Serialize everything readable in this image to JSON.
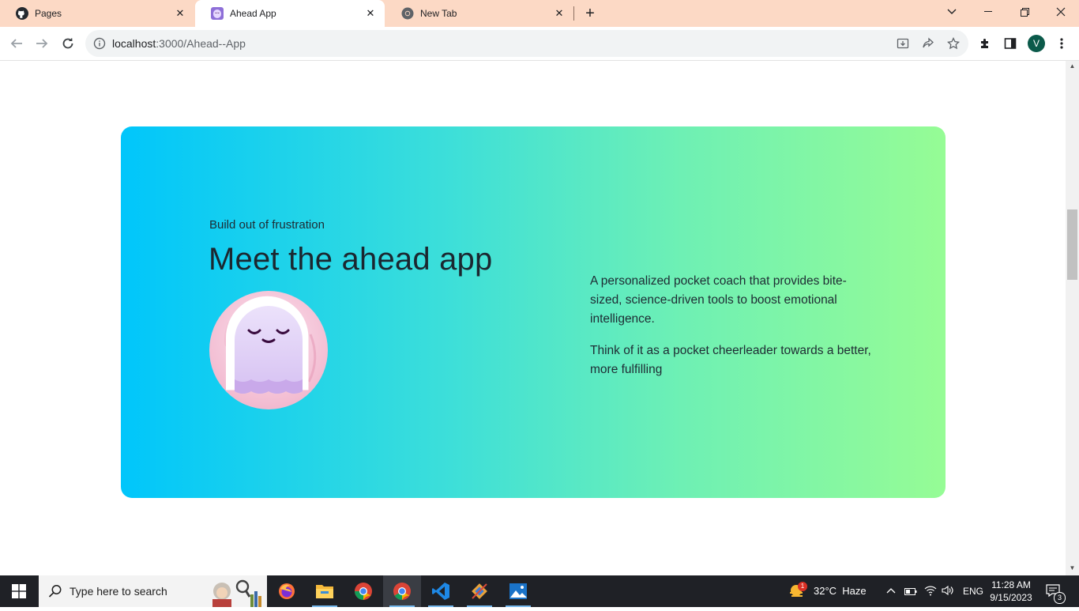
{
  "browser": {
    "tabs": [
      {
        "title": "Pages",
        "icon": "github-icon"
      },
      {
        "title": "Ahead App",
        "icon": "ahead-favicon",
        "active": true
      },
      {
        "title": "New Tab",
        "icon": "chrome-icon"
      }
    ],
    "url_host": "localhost",
    "url_rest": ":3000/Ahead--App",
    "profile_initial": "V"
  },
  "hero": {
    "eyebrow": "Build out of frustration",
    "title": "Meet the ahead app",
    "paragraph_1": "A personalized pocket coach that provides bite-sized, science-driven tools to boost emotional intelligence.",
    "paragraph_2": "Think of it as a pocket cheerleader towards a better, more fulfilling",
    "gradient_start": "#00c6fb",
    "gradient_end": "#96fc95"
  },
  "taskbar": {
    "search_placeholder": "Type here to search",
    "weather": "32°C  Haze",
    "weather_badge": "1",
    "language": "ENG",
    "time": "11:28 AM",
    "date": "9/15/2023",
    "notifications": "3"
  }
}
